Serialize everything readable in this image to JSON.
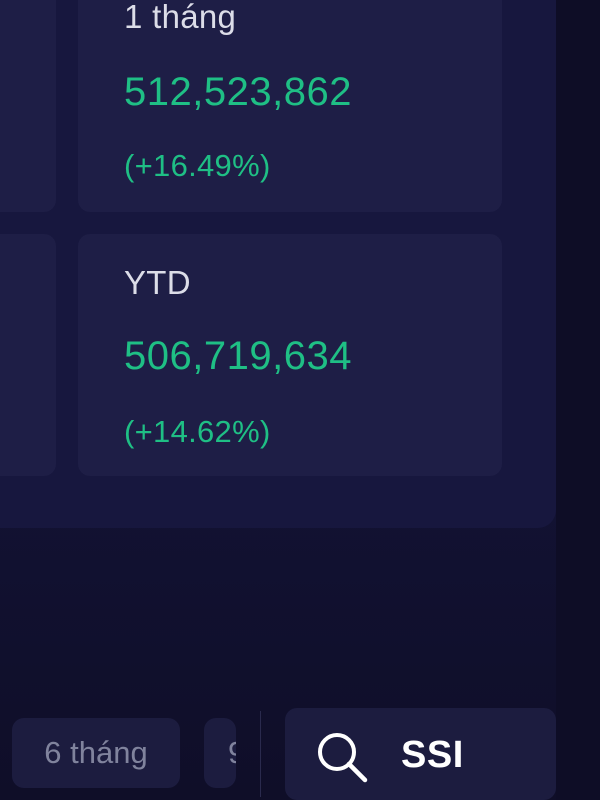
{
  "stats": {
    "one_month": {
      "label": "1 tháng",
      "value": "512,523,862",
      "change": "(+16.49%)"
    },
    "ytd": {
      "label": "YTD",
      "value": "506,719,634",
      "change": "(+14.62%)"
    }
  },
  "period_tabs": [
    {
      "label": "6 tháng"
    },
    {
      "label": "9"
    }
  ],
  "search": {
    "value": "SSI",
    "icon": "search-icon"
  },
  "colors": {
    "positive": "#1fbf85",
    "background": "#121233",
    "card": "#1e1e46"
  }
}
